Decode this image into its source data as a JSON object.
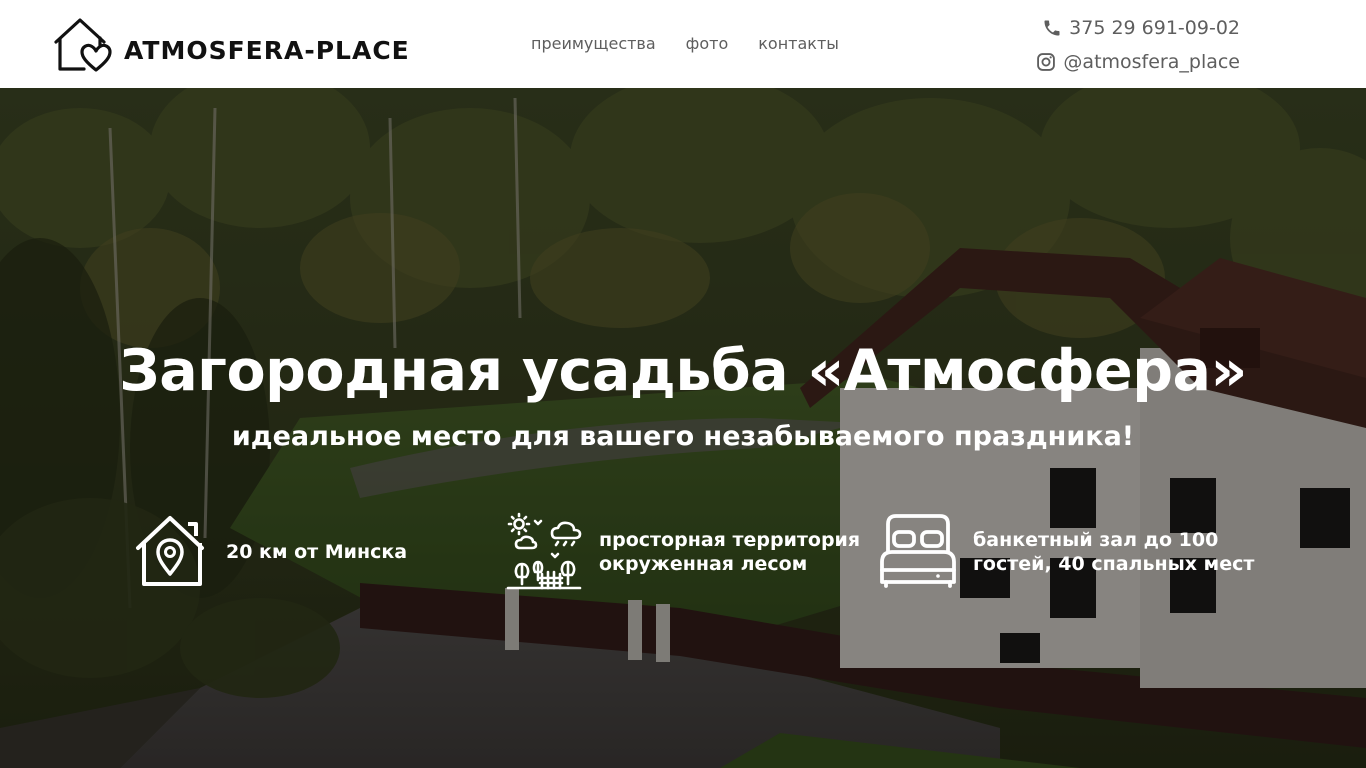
{
  "header": {
    "brand": "ATMOSFERA-PLACE",
    "nav": [
      {
        "label": "преимущества"
      },
      {
        "label": "фото"
      },
      {
        "label": "контакты"
      }
    ],
    "phone": "375 29 691-09-02",
    "instagram": "@atmosfera_place",
    "icons": {
      "logo": "house-heart-icon",
      "phone": "phone-icon",
      "instagram": "instagram-icon"
    }
  },
  "hero": {
    "title": "Загородная усадьба «Атмосфера»",
    "subtitle": "идеальное место для вашего незабываемого праздника!",
    "features": [
      {
        "icon": "house-location-icon",
        "text": "20 км от Минска"
      },
      {
        "icon": "nature-territory-icon",
        "text": "просторная территория окруженная лесом"
      },
      {
        "icon": "bed-icon",
        "text": "банкетный зал до 100 гостей, 40 спальных мест"
      }
    ]
  },
  "colors": {
    "header_bg": "#ffffff",
    "nav_text": "#5e5e5e",
    "brand_text": "#111111",
    "hero_text": "#ffffff",
    "hero_overlay": "rgba(0,0,0,0.42)"
  }
}
